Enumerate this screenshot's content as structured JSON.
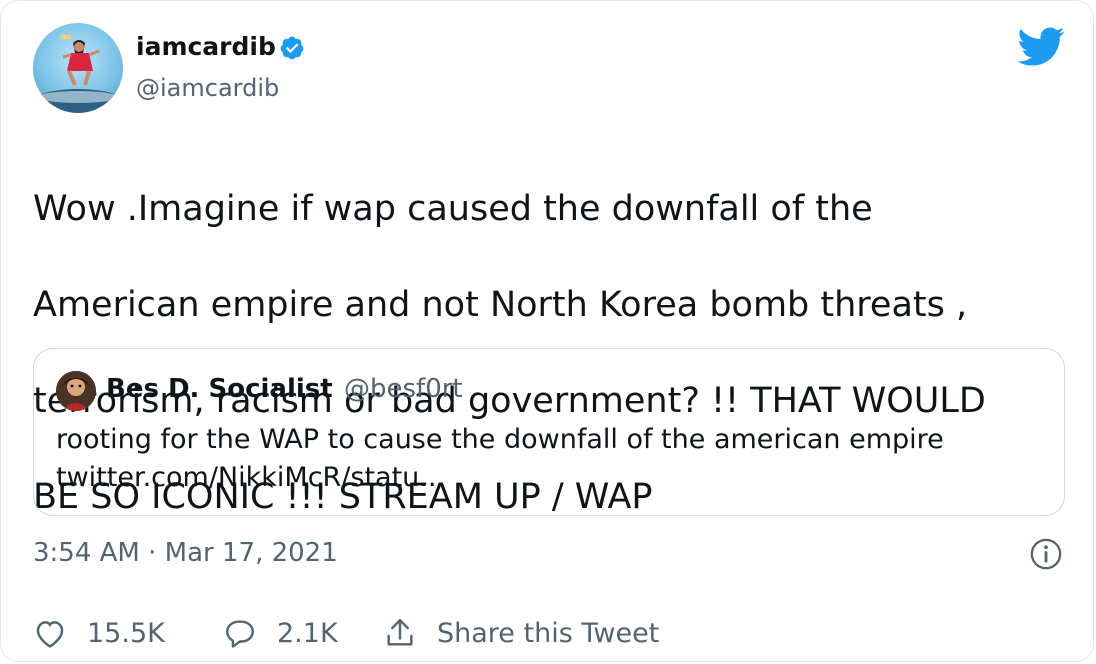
{
  "tweet": {
    "author": {
      "display_name": "iamcardib",
      "handle": "@iamcardib",
      "verified": true
    },
    "text_lines": [
      "Wow .Imagine if wap caused the downfall of the",
      "American empire and not North Korea bomb threats ,",
      "terrorism, racism or bad government? !! THAT WOULD",
      "BE SO ICONIC !!! STREAM UP / WAP"
    ],
    "timestamp": "3:54 AM · Mar 17, 2021"
  },
  "quoted_tweet": {
    "display_name": "Bes D. Socialist",
    "handle": "@besf0rt",
    "text": "rooting for the WAP to cause the downfall of the american empire",
    "link": "twitter.com/NikkiMcR/statu..."
  },
  "actions": {
    "like_count": "15.5K",
    "reply_count": "2.1K",
    "share_label": "Share this Tweet"
  },
  "icons": {
    "brand": "twitter-bird-icon",
    "verified": "verified-badge-icon",
    "info": "info-icon",
    "like": "heart-icon",
    "reply": "speech-bubble-icon",
    "share": "share-upload-icon"
  },
  "colors": {
    "brand_blue": "#1d9bf0",
    "text": "#0f1419",
    "secondary_text": "#536471",
    "border": "#cfd9de"
  }
}
